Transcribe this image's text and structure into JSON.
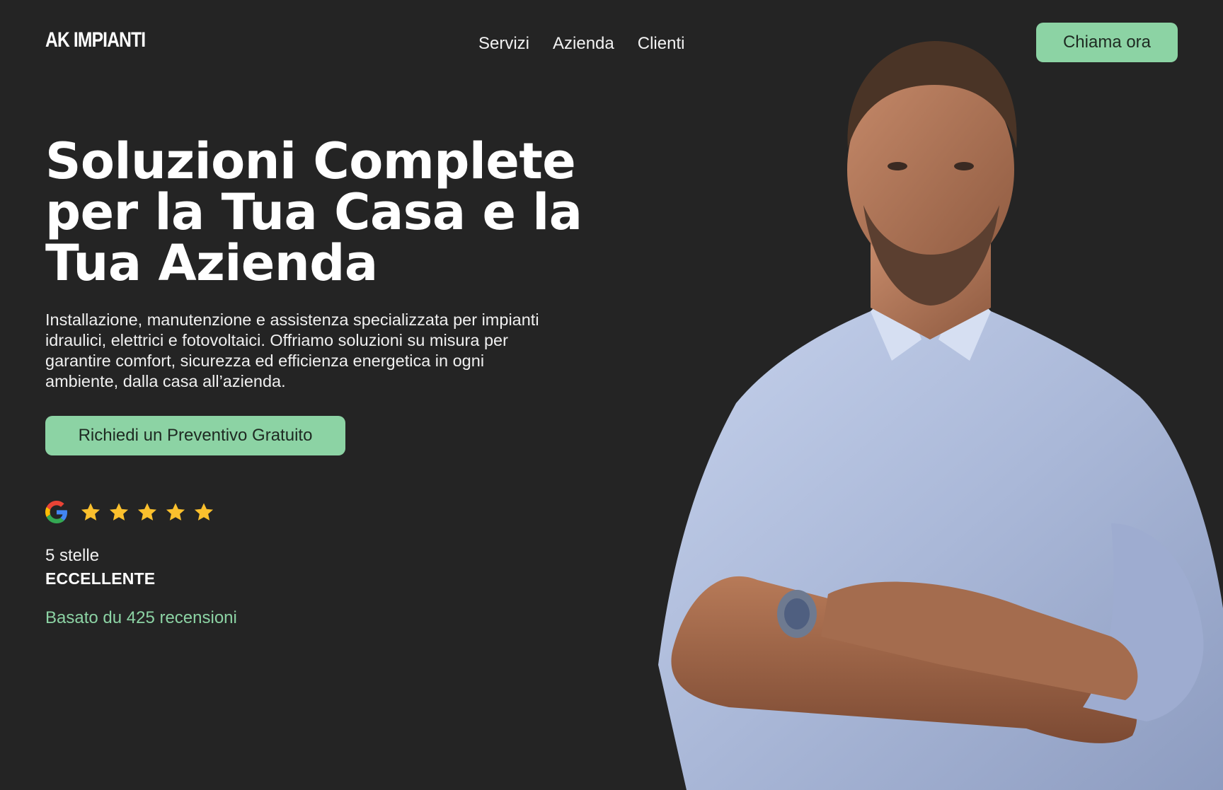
{
  "brand": {
    "logo_text": "AK IMPIANTI"
  },
  "nav": {
    "items": [
      {
        "label": "Servizi"
      },
      {
        "label": "Azienda"
      },
      {
        "label": "Clienti"
      }
    ]
  },
  "header": {
    "call_button_label": "Chiama ora"
  },
  "hero": {
    "title": "Soluzioni Complete per la Tua Casa e la Tua Azienda",
    "description": "Installazione, manutenzione e assistenza specializzata per impianti idraulici, elettrici e fotovoltaici. Offriamo soluzioni su misura per garantire comfort, sicurezza ed efficienza energetica in ogni ambiente, dalla casa all’azienda.",
    "cta_label": "Richiedi un Preventivo Gratuito"
  },
  "rating": {
    "source_icon": "google-icon",
    "stars": 5,
    "stars_text": "5 stelle",
    "label": "ECCELLENTE",
    "reviews_text": "Basato du 425 recensioni"
  },
  "colors": {
    "background": "#242424",
    "accent": "#8cd3a4",
    "star": "#fbc02d"
  }
}
